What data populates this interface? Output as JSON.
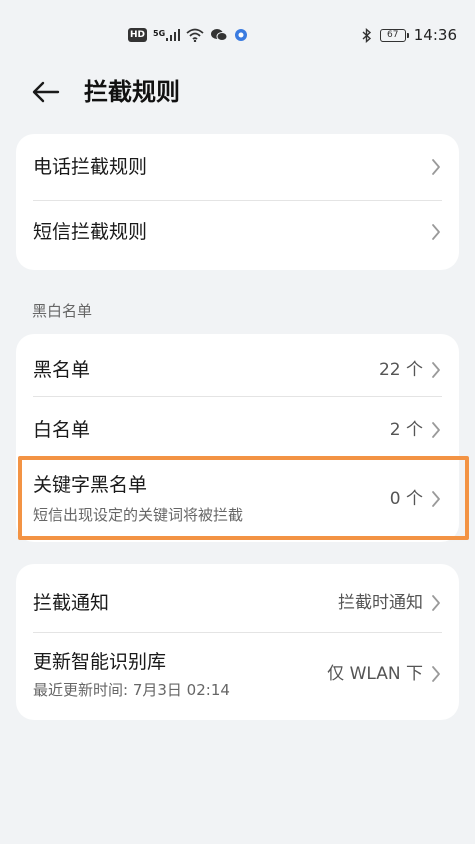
{
  "status_bar": {
    "hd": "HD",
    "signal": "5G",
    "battery": "67",
    "time": "14:36"
  },
  "header": {
    "title": "拦截规则"
  },
  "card_rules": {
    "items": [
      {
        "label": "电话拦截规则"
      },
      {
        "label": "短信拦截规则"
      }
    ]
  },
  "section_lists": {
    "header": "黑白名单",
    "items": [
      {
        "label": "黑名单",
        "value": "22 个"
      },
      {
        "label": "白名单",
        "value": "2 个"
      },
      {
        "label": "关键字黑名单",
        "subtitle": "短信出现设定的关键词将被拦截",
        "value": "0 个"
      }
    ]
  },
  "card_settings": {
    "items": [
      {
        "label": "拦截通知",
        "value": "拦截时通知"
      },
      {
        "label": "更新智能识别库",
        "subtitle": "最近更新时间: 7月3日 02:14",
        "value": "仅 WLAN 下"
      }
    ]
  },
  "colors": {
    "background": "#f1f3f5",
    "card": "#ffffff",
    "highlight_border": "#f39344"
  }
}
